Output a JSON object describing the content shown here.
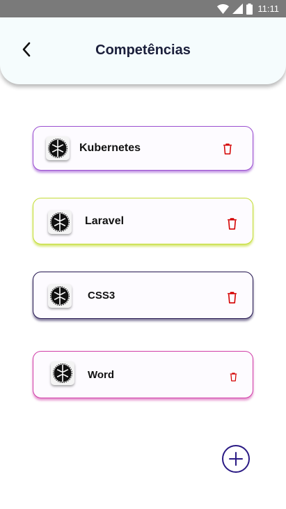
{
  "status_bar": {
    "time": "11:11",
    "icons": [
      "wifi-icon",
      "signal-icon",
      "battery-icon"
    ]
  },
  "header": {
    "title": "Competências",
    "back_icon": "chevron-left-icon"
  },
  "skills": [
    {
      "name": "Kubernetes",
      "border_color": "#9a4fd0",
      "icon": "brain-icon",
      "delete_icon": "trash-icon"
    },
    {
      "name": "Laravel",
      "border_color": "#c4dd36",
      "icon": "brain-icon",
      "delete_icon": "trash-icon"
    },
    {
      "name": "CSS3",
      "border_color": "#23154f",
      "icon": "brain-icon",
      "delete_icon": "trash-icon"
    },
    {
      "name": "Word",
      "border_color": "#d03ea8",
      "icon": "brain-icon",
      "delete_icon": "trash-icon"
    }
  ],
  "add_button": {
    "icon": "plus-icon",
    "color": "#2a1a84"
  },
  "colors": {
    "delete": "#d40000",
    "header_bg": "#f5fcfd",
    "title": "#1b1f3b"
  }
}
